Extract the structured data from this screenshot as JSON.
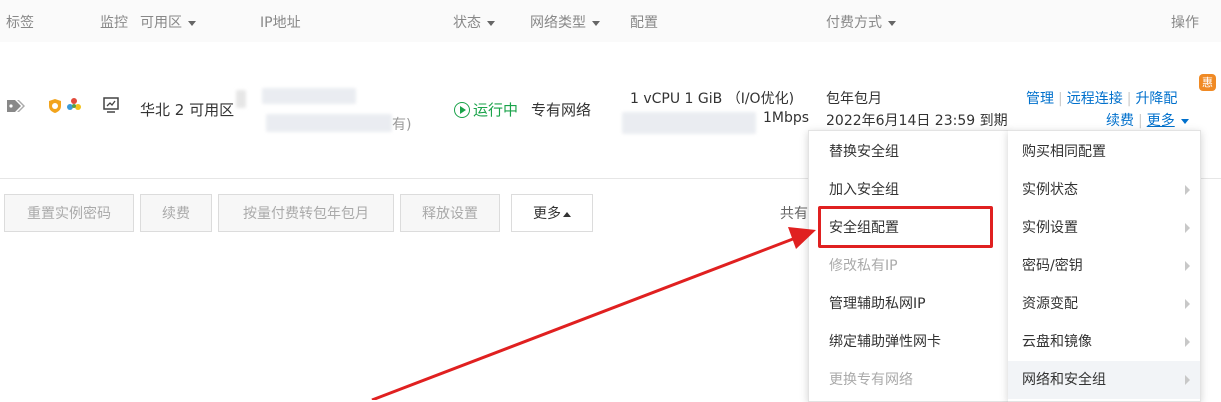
{
  "header": {
    "tag": "标签",
    "monitor": "监控",
    "zone": "可用区",
    "ip": "IP地址",
    "status": "状态",
    "network_type": "网络类型",
    "config": "配置",
    "billing": "付费方式",
    "actions": "操作"
  },
  "row": {
    "zone": "华北 2 可用区",
    "ip_suffix": "有)",
    "status": "运行中",
    "network_type": "专有网络",
    "config_line1": "1 vCPU 1 GiB （I/O优化)",
    "bandwidth": "1Mbps",
    "billing_type": "包年包月",
    "expire": "2022年6月14日 23:59 到期",
    "action_manage": "管理",
    "action_remote": "远程连接",
    "action_upgrade": "升降配",
    "action_renew": "续费",
    "action_more": "更多",
    "badge": "惠"
  },
  "toolbar": {
    "reset_password": "重置实例密码",
    "renew": "续费",
    "convert": "按量付费转包年包月",
    "release": "释放设置",
    "more": "更多",
    "total_prefix": "共有"
  },
  "menu_left": [
    {
      "label": "替换安全组"
    },
    {
      "label": "加入安全组"
    },
    {
      "label": "安全组配置"
    },
    {
      "label": "修改私有IP"
    },
    {
      "label": "管理辅助私网IP"
    },
    {
      "label": "绑定辅助弹性网卡"
    },
    {
      "label": "更换专有网络"
    }
  ],
  "menu_right": [
    {
      "label": "购买相同配置"
    },
    {
      "label": "实例状态"
    },
    {
      "label": "实例设置"
    },
    {
      "label": "密码/密钥"
    },
    {
      "label": "资源变配"
    },
    {
      "label": "云盘和镜像"
    },
    {
      "label": "网络和安全组"
    }
  ],
  "colors": {
    "link": "#0070cc",
    "running": "#1aa34a",
    "highlight_box": "#e02020",
    "badge": "#f08a24"
  }
}
